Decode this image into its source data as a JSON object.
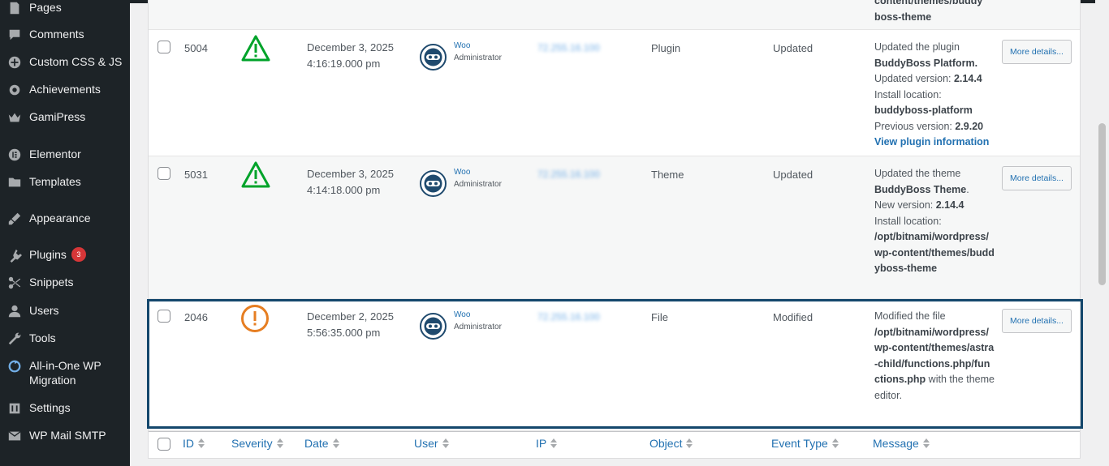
{
  "sidebar": {
    "items": [
      {
        "label": "Pages",
        "icon": "pages-icon"
      },
      {
        "label": "Comments",
        "icon": "comments-icon"
      },
      {
        "label": "Custom CSS & JS",
        "icon": "plus-circle-icon"
      },
      {
        "label": "Achievements",
        "icon": "gear-icon"
      },
      {
        "label": "GamiPress",
        "icon": "crown-icon"
      },
      {
        "label": "Elementor",
        "icon": "elementor-icon"
      },
      {
        "label": "Templates",
        "icon": "folder-icon"
      },
      {
        "label": "Appearance",
        "icon": "brush-icon"
      },
      {
        "label": "Plugins",
        "icon": "plugin-icon",
        "badge": "3"
      },
      {
        "label": "Snippets",
        "icon": "scissors-icon"
      },
      {
        "label": "Users",
        "icon": "user-icon"
      },
      {
        "label": "Tools",
        "icon": "wrench-icon"
      },
      {
        "label": "All-in-One WP Migration",
        "icon": "migration-icon"
      },
      {
        "label": "Settings",
        "icon": "settings-icon"
      },
      {
        "label": "WP Mail SMTP",
        "icon": "mail-icon"
      }
    ]
  },
  "top_partial": {
    "message_tail_1": "content/themes/buddy",
    "message_tail_2": "boss-theme"
  },
  "rows": [
    {
      "id": "5004",
      "severity": "warning",
      "date_line1": "December 3, 2025",
      "date_line2": "4:16:19.000 pm",
      "user_name": "Woo",
      "user_role": "Administrator",
      "ip": "72.255.16.100",
      "object": "Plugin",
      "event_type": "Updated",
      "message": {
        "l1": "Updated the plugin",
        "l2": "BuddyBoss Platform.",
        "l3a": "Updated version: ",
        "l3b": "2.14.4",
        "l4": "Install location:",
        "l5": "buddyboss-platform",
        "l6a": "Previous version: ",
        "l6b": "2.9.20",
        "l7": "View plugin information"
      },
      "button": "More details..."
    },
    {
      "id": "5031",
      "severity": "warning",
      "date_line1": "December 3, 2025",
      "date_line2": "4:14:18.000 pm",
      "user_name": "Woo",
      "user_role": "Administrator",
      "ip": "72.255.16.100",
      "object": "Theme",
      "event_type": "Updated",
      "message": {
        "l1": "Updated the theme",
        "l2": "BuddyBoss Theme",
        "l3a": "New version: ",
        "l3b": "2.14.4",
        "l4": "Install location:",
        "l5": "/opt/bitnami/wordpress/wp-content/themes/buddyboss-theme"
      },
      "button": "More details..."
    },
    {
      "id": "2046",
      "severity": "critical",
      "date_line1": "December 2, 2025",
      "date_line2": "5:56:35.000 pm",
      "user_name": "Woo",
      "user_role": "Administrator",
      "ip": "72.255.16.100",
      "object": "File",
      "event_type": "Modified",
      "message": {
        "l1": "Modified the file",
        "l2": "/opt/bitnami/wordpress/wp-content/themes/astra-child/functions.php/functions.php",
        "l3": " with the theme editor."
      },
      "button": "More details..."
    }
  ],
  "columns": [
    "ID",
    "Severity",
    "Date",
    "User",
    "IP",
    "Object",
    "Event Type",
    "Message"
  ],
  "colors": {
    "sidebar_bg": "#1d2327",
    "link": "#2271b1",
    "warning": "#00a32a",
    "critical": "#e67e22",
    "highlight": "#14476c",
    "badge": "#d63638"
  }
}
